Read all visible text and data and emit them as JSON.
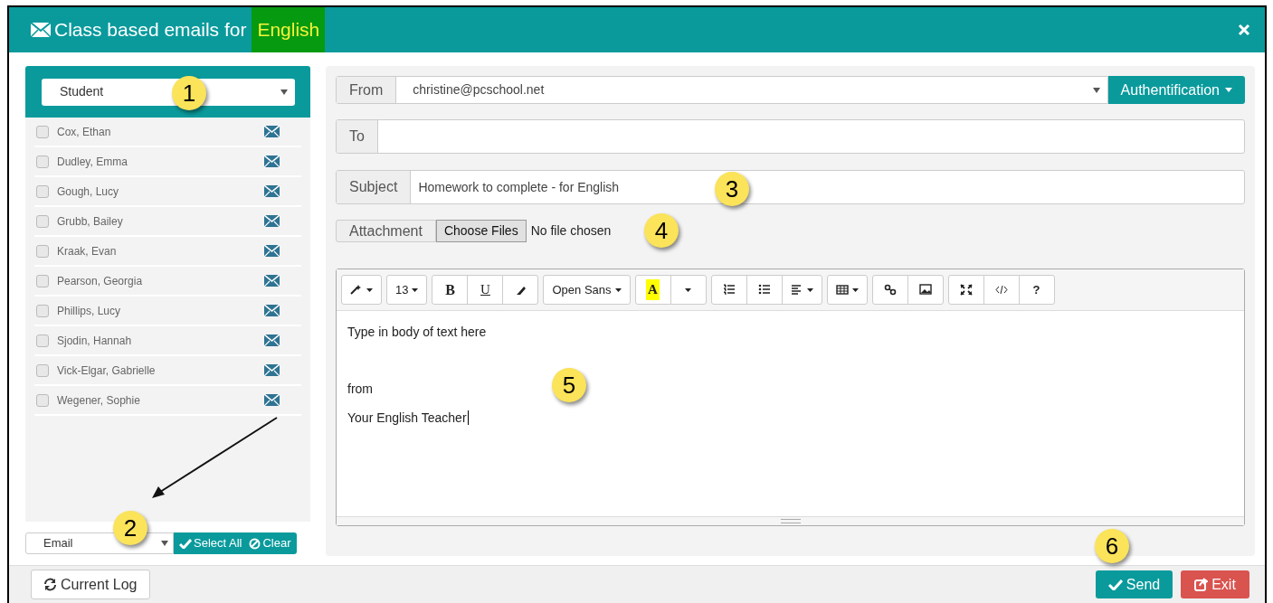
{
  "dialog": {
    "title": "Class based emails for",
    "title_highlight": "English"
  },
  "recipients": {
    "group_select": "Student",
    "students": [
      {
        "name": "Cox, Ethan",
        "checked": false
      },
      {
        "name": "Dudley, Emma",
        "checked": false
      },
      {
        "name": "Gough, Lucy",
        "checked": false
      },
      {
        "name": "Grubb, Bailey",
        "checked": false
      },
      {
        "name": "Kraak, Evan",
        "checked": false
      },
      {
        "name": "Pearson, Georgia",
        "checked": false
      },
      {
        "name": "Phillips, Lucy",
        "checked": false
      },
      {
        "name": "Sjodin, Hannah",
        "checked": false
      },
      {
        "name": "Vick-Elgar, Gabrielle",
        "checked": false
      },
      {
        "name": "Wegener, Sophie",
        "checked": false
      }
    ],
    "method_select": "Email",
    "select_all": "Select All",
    "clear": "Clear"
  },
  "message": {
    "from_label": "From",
    "from_value": "christine@pcschool.net",
    "auth_button": "Authentification",
    "to_label": "To",
    "subject_label": "Subject",
    "subject_value": "Homework to complete - for English",
    "attachment_label": "Attachment",
    "choose_files": "Choose Files",
    "no_file": "No file chosen",
    "toolbar": [
      [
        {
          "kind": "wand",
          "dropdown": true
        }
      ],
      [
        {
          "kind": "text",
          "label": "13",
          "dropdown": true
        }
      ],
      [
        {
          "kind": "bold",
          "label": "B"
        },
        {
          "kind": "underline",
          "label": "U"
        },
        {
          "kind": "eraser"
        }
      ],
      [
        {
          "kind": "text",
          "label": "Open Sans",
          "dropdown": true
        }
      ],
      [
        {
          "kind": "highlight",
          "label": "A"
        },
        {
          "kind": "caret"
        }
      ],
      [
        {
          "kind": "ol"
        },
        {
          "kind": "ul"
        },
        {
          "kind": "align",
          "dropdown": true
        }
      ],
      [
        {
          "kind": "table",
          "dropdown": true
        }
      ],
      [
        {
          "kind": "link"
        },
        {
          "kind": "picture"
        }
      ],
      [
        {
          "kind": "fullscreen"
        },
        {
          "kind": "code"
        },
        {
          "kind": "help",
          "label": "?"
        }
      ]
    ],
    "body_lines": [
      {
        "text": "Type in body of text here",
        "caret": false
      },
      {
        "text": "from",
        "caret": false
      },
      {
        "text": "Your English Teacher",
        "caret": true
      }
    ]
  },
  "footer": {
    "log_button": "Current Log",
    "send": "Send",
    "exit": "Exit"
  },
  "callouts": [
    "1",
    "2",
    "3",
    "4",
    "5",
    "6"
  ]
}
